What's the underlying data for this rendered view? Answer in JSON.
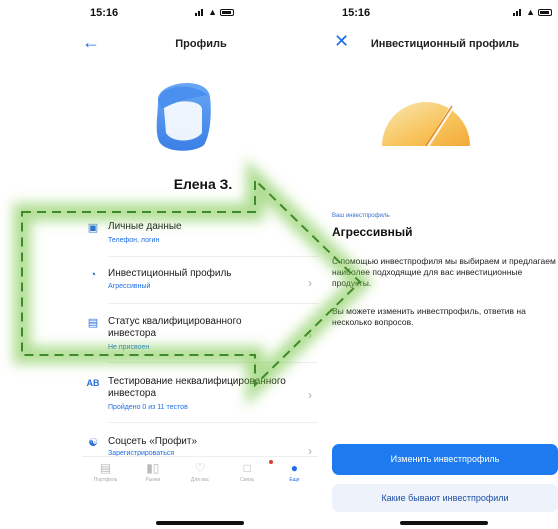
{
  "left_screen": {
    "status": {
      "time": "15:16"
    },
    "nav": {
      "title": "Профиль"
    },
    "profile": {
      "name": "Елена З."
    },
    "menu": [
      {
        "title": "Личные данные",
        "subtitle": "Телефон, логин",
        "icon": "id-card-icon"
      },
      {
        "title": "Инвестиционный профиль",
        "subtitle": "Агрессивный",
        "icon": "gauge-icon"
      },
      {
        "title": "Статус квалифицированного инвестора",
        "subtitle": "Не присвоен",
        "icon": "briefcase-icon"
      },
      {
        "title": "Тестирование неквалифицированного инвестора",
        "subtitle": "Пройдено 0 из 11 тестов",
        "icon": "ab-test-icon"
      },
      {
        "title": "Соцсеть «Профит»",
        "subtitle": "Зарегистрироваться",
        "icon": "network-icon"
      }
    ],
    "tabbar": [
      {
        "label": "Портфель",
        "icon": "briefcase-icon"
      },
      {
        "label": "Рынки",
        "icon": "candles-icon"
      },
      {
        "label": "Для вас",
        "icon": "heart-icon"
      },
      {
        "label": "Связь",
        "icon": "chat-icon"
      },
      {
        "label": "Еще",
        "icon": "person-icon"
      }
    ]
  },
  "right_screen": {
    "status": {
      "time": "15:16"
    },
    "nav": {
      "title": "Инвестиционный профиль"
    },
    "caption": "Ваш инвестпрофиль",
    "profile_type": "Агрессивный",
    "paragraph1": "С помощью инвестпрофиля мы выбираем и предлагаем наиболее подходящие для вас инвестиционные продукты.",
    "paragraph2": "Вы можете изменить инвестпрофиль, ответив на несколько вопросов.",
    "primary_button": "Изменить инвестпрофиль",
    "secondary_button": "Какие бывают инвестпрофили"
  },
  "colors": {
    "accent": "#1e7bef",
    "arrow_green": "#6fc23a",
    "gauge_orange": "#f7c35a"
  }
}
